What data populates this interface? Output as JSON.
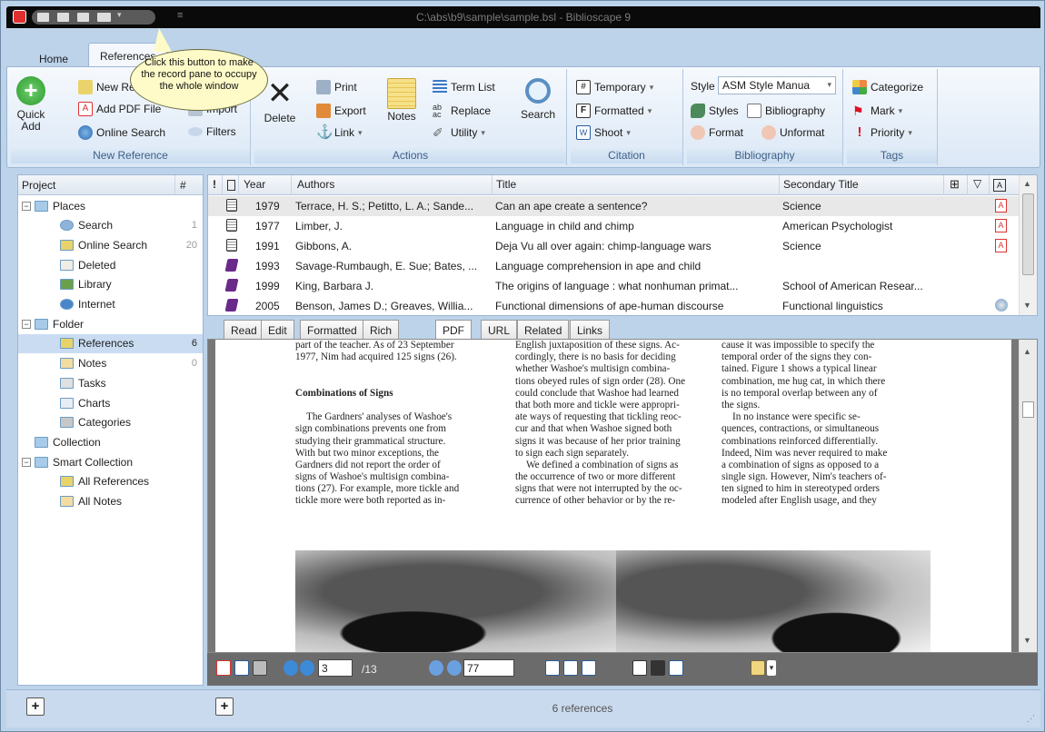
{
  "window": {
    "title": "C:\\abs\\b9\\sample\\sample.bsl - Biblioscape 9"
  },
  "ribbon_tabs": [
    {
      "label": "Home"
    },
    {
      "label": "References"
    }
  ],
  "tooltip": {
    "text": "Click this button to make the record pane to occupy the whole window"
  },
  "ribbon": {
    "new_reference": {
      "label": "New Reference",
      "quick_add": "Quick Add",
      "new": "New Reference",
      "add_pdf": "Add PDF File",
      "import": "Import",
      "online_search": "Online Search",
      "filters": "Filters"
    },
    "actions": {
      "label": "Actions",
      "delete": "Delete",
      "print": "Print",
      "export": "Export",
      "link": "Link",
      "notes": "Notes",
      "term_list": "Term List",
      "replace": "Replace",
      "utility": "Utility",
      "search": "Search"
    },
    "citation": {
      "label": "Citation",
      "temporary": "Temporary",
      "formatted": "Formatted",
      "shoot": "Shoot"
    },
    "bibliography": {
      "label": "Bibliography",
      "style_label": "Style",
      "style_value": "ASM Style Manua",
      "styles": "Styles",
      "bibliography": "Bibliography",
      "format": "Format",
      "unformat": "Unformat"
    },
    "tags": {
      "label": "Tags",
      "categorize": "Categorize",
      "mark": "Mark",
      "priority": "Priority"
    }
  },
  "project_panel": {
    "header": "Project",
    "count_header": "#",
    "items": [
      {
        "label": "Places",
        "count": "",
        "icon": "folder-icon"
      },
      {
        "label": "Search",
        "count": "1",
        "icon": "search-icon"
      },
      {
        "label": "Online Search",
        "count": "20",
        "icon": "list-icon"
      },
      {
        "label": "Deleted",
        "count": "",
        "icon": "trash-icon"
      },
      {
        "label": "Library",
        "count": "",
        "icon": "book-icon"
      },
      {
        "label": "Internet",
        "count": "",
        "icon": "globe-icon"
      },
      {
        "label": "Folder",
        "count": "",
        "icon": "folder-icon"
      },
      {
        "label": "References",
        "count": "6",
        "icon": "list-icon"
      },
      {
        "label": "Notes",
        "count": "0",
        "icon": "notes-icon"
      },
      {
        "label": "Tasks",
        "count": "",
        "icon": "calendar-icon"
      },
      {
        "label": "Charts",
        "count": "",
        "icon": "chart-icon"
      },
      {
        "label": "Categories",
        "count": "",
        "icon": "tag-icon"
      },
      {
        "label": "Collection",
        "count": "",
        "icon": "folder-icon"
      },
      {
        "label": "Smart Collection",
        "count": "",
        "icon": "folder-icon"
      },
      {
        "label": "All References",
        "count": "",
        "icon": "list-icon"
      },
      {
        "label": "All Notes",
        "count": "",
        "icon": "notes-icon"
      }
    ]
  },
  "grid": {
    "headers": {
      "priority": "!",
      "type": "",
      "year": "Year",
      "authors": "Authors",
      "title": "Title",
      "secondary": "Secondary Title"
    },
    "rows": [
      {
        "year": "1979",
        "authors": "Terrace, H. S.; Petitto, L. A.; Sande...",
        "title": "Can an ape create a sentence?",
        "secondary": "Science",
        "type": "journal",
        "attach": "pdf"
      },
      {
        "year": "1977",
        "authors": "Limber, J.",
        "title": "Language in child and chimp",
        "secondary": "American Psychologist",
        "type": "journal",
        "attach": "pdf"
      },
      {
        "year": "1991",
        "authors": "Gibbons, A.",
        "title": "Deja Vu all over again: chimp-language wars",
        "secondary": "Science",
        "type": "journal",
        "attach": "pdf"
      },
      {
        "year": "1993",
        "authors": "Savage-Rumbaugh, E. Sue; Bates, ...",
        "title": "Language comprehension in ape and child",
        "secondary": "",
        "type": "book",
        "attach": ""
      },
      {
        "year": "1999",
        "authors": "King, Barbara J.",
        "title": "The origins of language : what nonhuman primat...",
        "secondary": "School of American Resear...",
        "type": "book",
        "attach": ""
      },
      {
        "year": "2005",
        "authors": "Benson, James D.; Greaves, Willia...",
        "title": "Functional dimensions of ape-human discourse",
        "secondary": "Functional linguistics",
        "type": "book",
        "attach": "web"
      }
    ]
  },
  "view_tabs": [
    "Read",
    "Edit",
    "Formatted",
    "Rich Text",
    "PDF",
    "URL",
    "Related",
    "Links"
  ],
  "pdf": {
    "col1": [
      "part of the teacher. As of 23 September",
      "1977, Nim had acquired 125 signs (26).",
      "",
      "",
      "Combinations of Signs",
      "",
      "The Gardners' analyses of Washoe's",
      "sign combinations prevents one from",
      "studying their grammatical structure.",
      "With but two minor exceptions, the",
      "Gardners did not report the order of",
      "signs of Washoe's multisign combina-",
      "tions (27). For example, more tickle and",
      "tickle more were both reported as in-"
    ],
    "col2": [
      "English juxtaposition of these signs. Ac-",
      "cordingly, there is no basis for deciding",
      "whether Washoe's multisign combina-",
      "tions obeyed rules of sign order (28). One",
      "could conclude that Washoe had learned",
      "that both more and tickle were appropri-",
      "ate ways of requesting that tickling reoc-",
      "cur and that when Washoe signed both",
      "signs it was because of her prior training",
      "to sign each sign separately.",
      "We defined a combination of signs as",
      "the occurrence of two or more different",
      "signs that were not interrupted by the oc-",
      "currence of other behavior or by the re-"
    ],
    "col3": [
      "cause it was impossible to specify the",
      "temporal order of the signs they con-",
      "tained. Figure 1 shows a typical linear",
      "combination, me hug cat, in which there",
      "is no temporal overlap between any of",
      "the signs.",
      "In no instance were specific se-",
      "quences, contractions, or simultaneous",
      "combinations reinforced differentially.",
      "Indeed, Nim was never required to make",
      "a combination of signs as opposed to a",
      "single sign. However, Nim's teachers of-",
      "ten signed to him in stereotyped orders",
      "modeled after English usage, and they"
    ]
  },
  "pdf_toolbar": {
    "page": "3",
    "total": "/13",
    "zoom": "77"
  },
  "status": {
    "text": "6 references",
    "plus": "+"
  }
}
